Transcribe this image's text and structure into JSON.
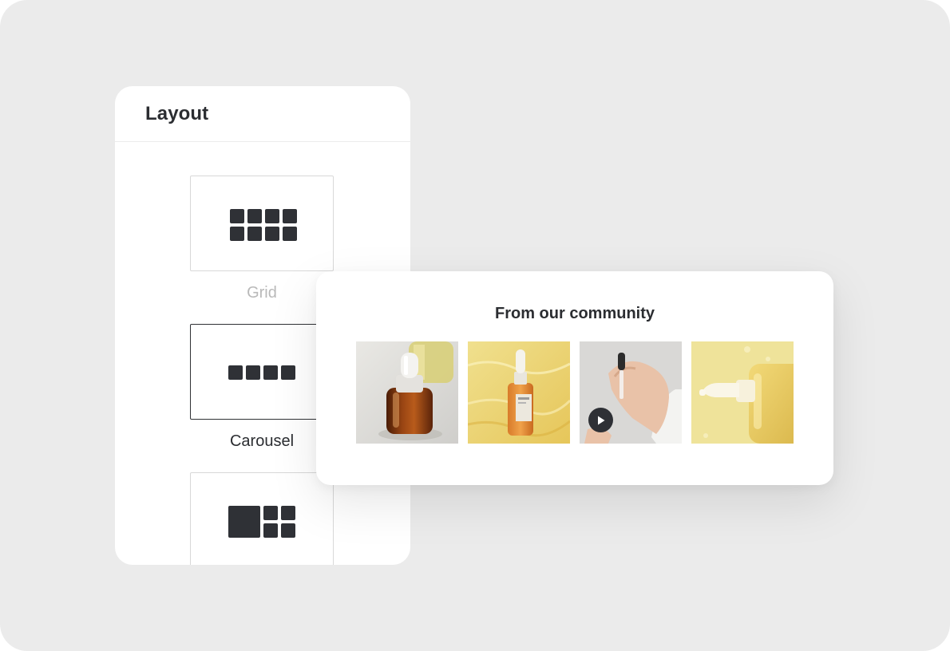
{
  "layout_panel": {
    "title": "Layout",
    "options": [
      {
        "label": "Grid",
        "selected": false,
        "icon": "grid-layout-icon"
      },
      {
        "label": "Carousel",
        "selected": true,
        "icon": "carousel-layout-icon"
      },
      {
        "label": "",
        "selected": false,
        "icon": "collage-layout-icon"
      }
    ]
  },
  "community": {
    "title": "From our community",
    "posts": [
      {
        "type": "image",
        "subject": "amber dropper bottle"
      },
      {
        "type": "image",
        "subject": "serum bottle in yellow water"
      },
      {
        "type": "video",
        "subject": "hand holding dropper",
        "icon": "play-icon"
      },
      {
        "type": "image",
        "subject": "yellow pump bottle"
      }
    ]
  },
  "colors": {
    "background": "#ebebeb",
    "icon_dark": "#2f3136",
    "text": "#2b2d31",
    "muted_text": "#b9b9b9"
  }
}
